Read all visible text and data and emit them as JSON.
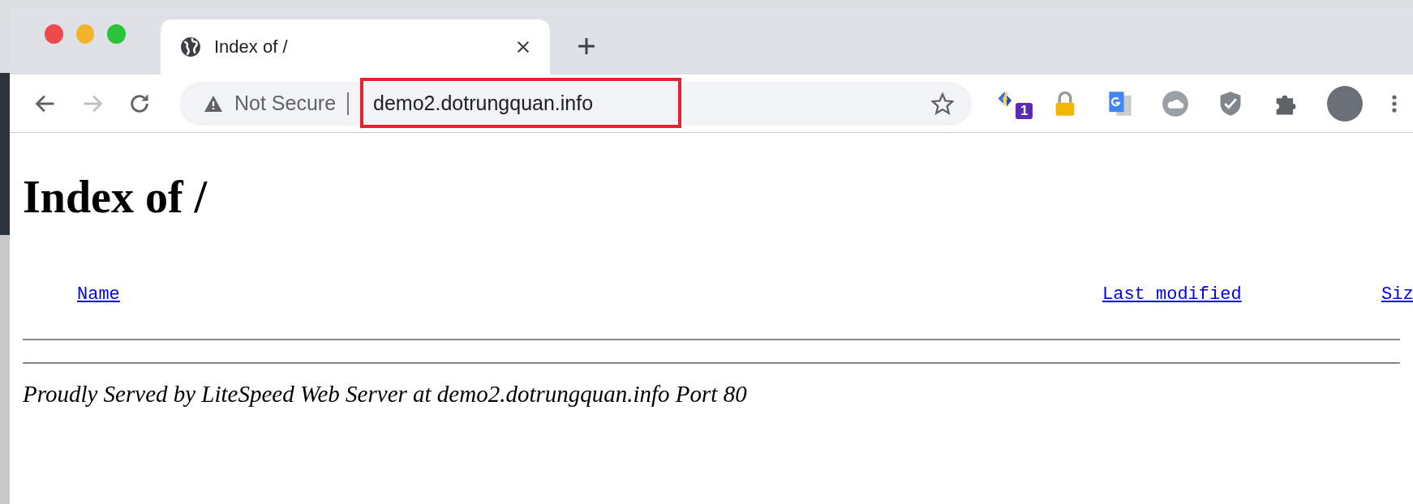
{
  "tab": {
    "title": "Index of /",
    "selected": true
  },
  "address_bar": {
    "security_label": "Not Secure",
    "url": "demo2.dotrungquan.info"
  },
  "extension_badge": "1",
  "page": {
    "heading": "Index of /",
    "columns": [
      {
        "label": "Name"
      },
      {
        "label": "Last modified"
      },
      {
        "label": "Siz"
      }
    ],
    "footer": "Proudly Served by LiteSpeed Web Server at demo2.dotrungquan.info Port 80"
  }
}
